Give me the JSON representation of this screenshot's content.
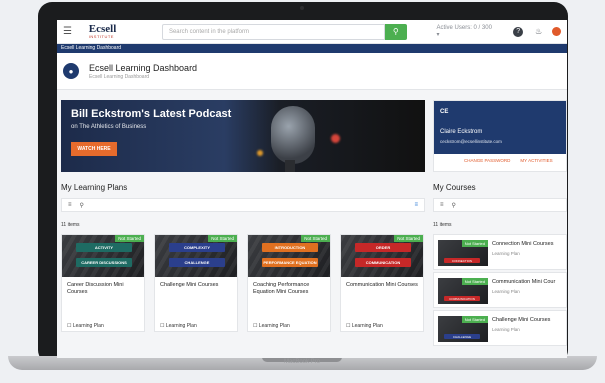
{
  "device": {
    "label": "MacBook Pro"
  },
  "topbar": {
    "logo_main": "Ecsell",
    "logo_sub": "INSTITUTE",
    "search_placeholder": "Search content in the platform",
    "active_users": "Active Users: 0 / 300 ▾"
  },
  "bluebar": {
    "title": "Ecsell Learning Dashboard"
  },
  "header": {
    "title": "Ecsell Learning Dashboard",
    "subtitle": "Ecsell Learning Dashboard"
  },
  "banner": {
    "title": "Bill Eckstrom's Latest Podcast",
    "subtitle": "on The Athletics of Business",
    "button": "WATCH HERE"
  },
  "profile": {
    "initials": "CE",
    "name": "Claire Eckstrom",
    "email": "ceckstrom@ecsellinstitute.com",
    "change_password": "CHANGE PASSWORD",
    "my_activities": "MY ACTIVITIES"
  },
  "learning_plans": {
    "title": "My Learning Plans",
    "count": "11 items",
    "cards": [
      {
        "status": "Not Started",
        "pill1": "ACTIVITY",
        "pill2": "CAREER DISCUSSIONS",
        "pill_color1": "#1e6b63",
        "pill_color2": "#1e6b63",
        "title": "Career Discussion Mini Courses",
        "footer": "Learning Plan"
      },
      {
        "status": "Not Started",
        "pill1": "COMPLEXITY",
        "pill2": "CHALLENGE",
        "pill_color1": "#2b3f8c",
        "pill_color2": "#2b3f8c",
        "title": "Challenge Mini Courses",
        "footer": "Learning Plan"
      },
      {
        "status": "Not Started",
        "pill1": "INTRODUCTION",
        "pill2": "PERFORMANCE EQUATION",
        "pill_color1": "#e07020",
        "pill_color2": "#e07020",
        "title": "Coaching Performance Equation Mini Courses",
        "footer": "Learning Plan"
      },
      {
        "status": "Not Started",
        "pill1": "ORDER",
        "pill2": "COMMUNICATION",
        "pill_color1": "#c62828",
        "pill_color2": "#c62828",
        "title": "Communication Mini Courses",
        "footer": "Learning Plan"
      }
    ]
  },
  "courses": {
    "title": "My Courses",
    "count": "11 items",
    "rows": [
      {
        "status": "Not Started",
        "mini_label": "CONNECTION",
        "mini_color": "#c62828",
        "title": "Connection Mini Courses",
        "subtitle": "Learning Plan"
      },
      {
        "status": "Not Started",
        "mini_label": "COMMUNICATION",
        "mini_color": "#c62828",
        "title": "Communication Mini Cour",
        "subtitle": "Learning Plan"
      },
      {
        "status": "Not Started",
        "mini_label": "CHALLENGE",
        "mini_color": "#2b3f8c",
        "title": "Challenge Mini Courses",
        "subtitle": "Learning Plan"
      }
    ]
  }
}
